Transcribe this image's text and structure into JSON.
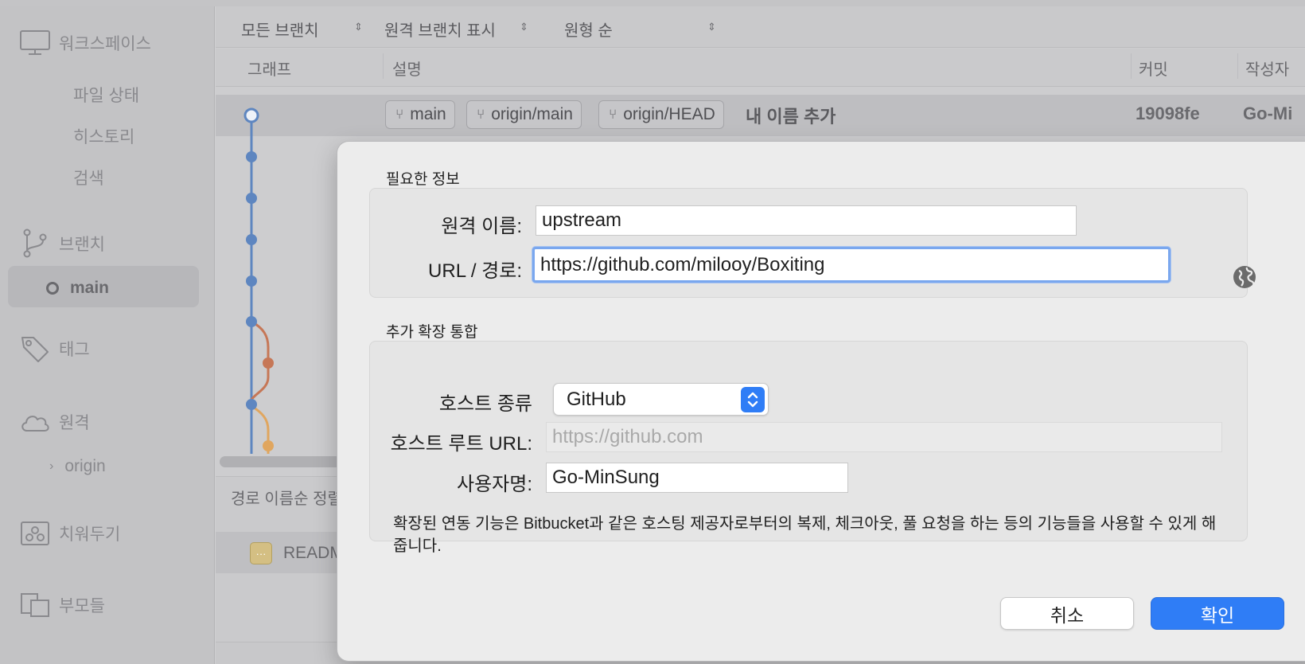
{
  "app": {
    "sidebar": {
      "workspace_label": "워크스페이스",
      "workspace_items": [
        "파일 상태",
        "히스토리",
        "검색"
      ],
      "branches_label": "브랜치",
      "current_branch": "main",
      "tags_label": "태그",
      "remotes_label": "원격",
      "remote_items": [
        "origin"
      ],
      "stashes_label": "치워두기",
      "parents_label": "부모들"
    },
    "toolbar": {
      "branch_filter": "모든 브랜치",
      "remote_toggle": "원격 브랜치 표시",
      "order": "원형 순"
    },
    "columns": {
      "graph": "그래프",
      "description": "설명",
      "commit": "커밋",
      "author": "작성자"
    },
    "commit": {
      "refs": [
        "main",
        "origin/main",
        "origin/HEAD"
      ],
      "message": "내 이름 추가",
      "hash": "19098fe",
      "author": "Go-Mi"
    },
    "lower_pane": {
      "sort_label": "경로 이름순 정렬",
      "file_name": "READM"
    },
    "colors": {
      "graph_main": "#5e86c0",
      "graph_branch_1": "#c67757",
      "graph_branch_2": "#e0a65f"
    }
  },
  "dialog": {
    "required_section": "필요한 정보",
    "remote_name_label": "원격 이름:",
    "remote_name_value": "upstream",
    "url_label": "URL / 경로:",
    "url_value": "https://github.com/milooy/Boxiting",
    "extension_section": "추가 확장 통합",
    "host_type_label": "호스트 종류",
    "host_type_value": "GitHub",
    "host_root_label": "호스트 루트 URL:",
    "host_root_placeholder": "https://github.com",
    "username_label": "사용자명:",
    "username_value": "Go-MinSung",
    "description": "확장된 연동 기능은 Bitbucket과 같은 호스팅 제공자로부터의 복제, 체크아웃, 풀 요청을 하는 등의 기능들을 사용할 수 있게 해줍니다.",
    "cancel_label": "취소",
    "ok_label": "확인",
    "accent_color": "#2f7df6"
  }
}
